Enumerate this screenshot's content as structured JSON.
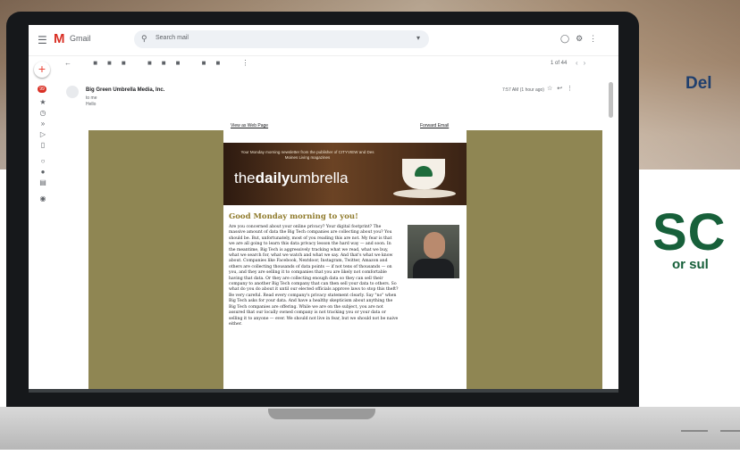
{
  "promo": {
    "title": "Del",
    "big_text": "SC",
    "sub_text": "or sul"
  },
  "gmail": {
    "app_name": "Gmail",
    "search_placeholder": "Search mail",
    "icons": {
      "menu": "menu-icon",
      "search": "search-icon",
      "compose": "compose-icon",
      "help": "help-icon",
      "settings": "settings-icon",
      "apps": "apps-icon"
    },
    "count_text": "1 of 44",
    "message": {
      "sender": "Big Green Umbrella Media, Inc.",
      "to_line": "to me",
      "sub_line": "Hello",
      "date": "7:57 AM (1 hour ago)"
    }
  },
  "email": {
    "link_left": "View as Web Page",
    "link_right": "Forward Email",
    "banner_tagline": "Your Monday morning newsletter from the publisher of CITYVIEW and Des Moines Living magazines",
    "brand_light_1": "the",
    "brand_bold": "daily",
    "brand_light_2": "umbrella",
    "greeting": "Good Monday morning to you!",
    "body": "Are you concerned about your online privacy? Your digital footprint? The massive amount of data the Big Tech companies are collecting about you? You should be. But, unfortunately, most of you reading this are not. My fear is that we are all going to learn this data privacy lesson the hard way — and soon. In the meantime, Big Tech is aggressively tracking what we read, what we buy, what we search for, what we watch and what we say. And that's what we know about. Companies like Facebook, Nextdoor, Instagram, Twitter, Amazon and others are collecting thousands of data points — if not tens of thousands — on you, and they are selling it to companies that you are likely not comfortable having that data. Or they are collecting enough data so they can sell their company to another Big Tech company that can then sell your data to others. So what do you do about it until our elected officials approve laws to stop this theft? Be very careful. Read every company's privacy statement clearly. Say \"no\" when Big Tech asks for your data. And have a healthy skepticism about anything the Big Tech companies are offering. While we are on the subject, you are not assured that our locally owned company is not tracking you or your data or selling it to anyone — ever. We should not live in fear, but we should not be naive either."
  },
  "colors": {
    "email_background": "#8f8653",
    "greeting": "#8f7a2b",
    "promo_green": "#17603a",
    "promo_blue": "#1f3f6e"
  }
}
